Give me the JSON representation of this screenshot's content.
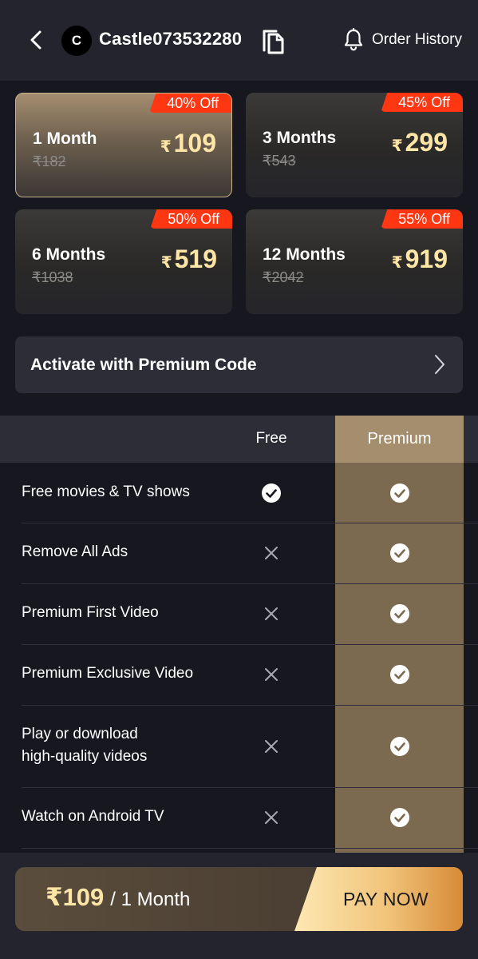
{
  "header": {
    "avatar_letter": "C",
    "username": "Castle073532280",
    "order_history_label": "Order History"
  },
  "plans": [
    {
      "duration": "1 Month",
      "original_price": "₹182",
      "currency": "₹",
      "price": "109",
      "discount": "40% Off",
      "selected": true
    },
    {
      "duration": "3 Months",
      "original_price": "₹543",
      "currency": "₹",
      "price": "299",
      "discount": "45% Off",
      "selected": false
    },
    {
      "duration": "6 Months",
      "original_price": "₹1038",
      "currency": "₹",
      "price": "519",
      "discount": "50% Off",
      "selected": false
    },
    {
      "duration": "12 Months",
      "original_price": "₹2042",
      "currency": "₹",
      "price": "919",
      "discount": "55% Off",
      "selected": false
    }
  ],
  "activate": {
    "label": "Activate with Premium Code"
  },
  "comparison": {
    "free_header": "Free",
    "premium_header": "Premium",
    "rows": [
      {
        "feature": "Free movies & TV shows",
        "free": true,
        "premium": true
      },
      {
        "feature": "Remove All Ads",
        "free": false,
        "premium": true
      },
      {
        "feature": "Premium First Video",
        "free": false,
        "premium": true
      },
      {
        "feature": "Premium Exclusive Video",
        "free": false,
        "premium": true
      },
      {
        "feature": "Play or download\nhigh-quality videos",
        "free": false,
        "premium": true
      },
      {
        "feature": "Watch on Android TV",
        "free": false,
        "premium": true
      }
    ]
  },
  "paybar": {
    "amount": "₹109",
    "period": "/ 1 Month",
    "pay_label": "PAY NOW"
  },
  "colors": {
    "background": "#16171f",
    "gold_text": "#ffe6a6",
    "discount_badge": "#ff3612",
    "premium_column": "#7c6a50"
  }
}
